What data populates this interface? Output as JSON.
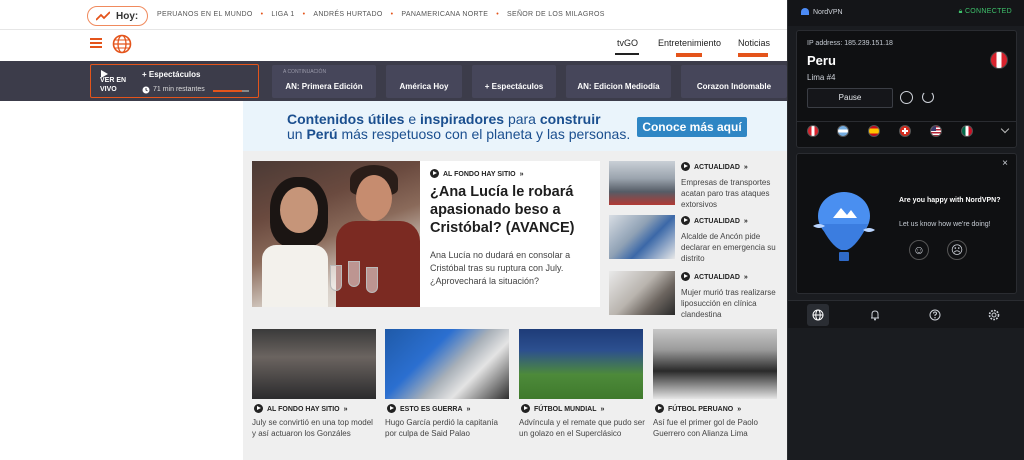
{
  "site": {
    "trending": {
      "label": "Hoy:",
      "links": [
        "PERUANOS EN EL MUNDO",
        "LIGA 1",
        "ANDRÉS HURTADO",
        "PANAMERICANA NORTE",
        "SEÑOR DE LOS MILAGROS"
      ]
    },
    "nav": [
      "tvGO",
      "Entretenimiento",
      "Noticias"
    ],
    "live": {
      "ver_en_vivo": "VER EN VIVO",
      "program": "+ Espectáculos",
      "remaining": "71 min restantes",
      "progress_fraction": 0.8,
      "next_label": "A CONTINUACIÓN",
      "schedule": [
        "AN: Primera Edición",
        "América Hoy",
        "+ Espectáculos",
        "AN: Edicion Mediodía",
        "Corazon Indomable"
      ]
    },
    "banner": {
      "line1_a": "Contenidos útiles",
      "line1_b": " e ",
      "line1_c": "inspiradores",
      "line1_d": " para ",
      "line1_e": "construir",
      "line2_a": "un ",
      "line2_b": "Perú",
      "line2_c": "  más respetuoso con el planeta y las personas.",
      "cta": "Conoce más aquí"
    },
    "feature": {
      "tag": "AL FONDO HAY SITIO",
      "headline": "¿Ana Lucía le robará apasionado beso a Cristóbal? (AVANCE)",
      "lede": "Ana Lucía no dudará en consolar a Cristóbal tras su ruptura con July. ¿Aprovechará la situación?"
    },
    "side": [
      {
        "tag": "ACTUALIDAD",
        "text": "Empresas de transportes acatan paro tras ataques extorsivos"
      },
      {
        "tag": "ACTUALIDAD",
        "text": "Alcalde de Ancón pide declarar en emergencia su distrito"
      },
      {
        "tag": "ACTUALIDAD",
        "text": "Mujer murió tras realizarse liposucción en clínica clandestina"
      }
    ],
    "cards": [
      {
        "tag": "AL FONDO HAY SITIO",
        "text": "July se convirtió en una top model y así actuaron los Gonzáles"
      },
      {
        "tag": "ESTO ES GUERRA",
        "text": "Hugo García perdió la capitanía por culpa de Said Palao"
      },
      {
        "tag": "FÚTBOL MUNDIAL",
        "text": "Advíncula y el remate que pudo ser un golazo en el Superclásico"
      },
      {
        "tag": "FÚTBOL PERUANO",
        "text": "Así fue el primer gol de Paolo Guerrero con Alianza Lima"
      }
    ],
    "chevron": "»"
  },
  "vpn": {
    "brand": "NordVPN",
    "status": "CONNECTED",
    "ip": "IP address: 185.239.151.18",
    "country": "Peru",
    "server": "Lima #4",
    "pause": "Pause",
    "feedback": {
      "question": "Are you happy with NordVPN?",
      "prompt": "Let us know how we're doing!",
      "close": "×",
      "happy": "☺",
      "sad": "☹"
    },
    "tabs": [
      "globe-icon",
      "bell-icon",
      "help-icon",
      "settings-icon"
    ]
  }
}
